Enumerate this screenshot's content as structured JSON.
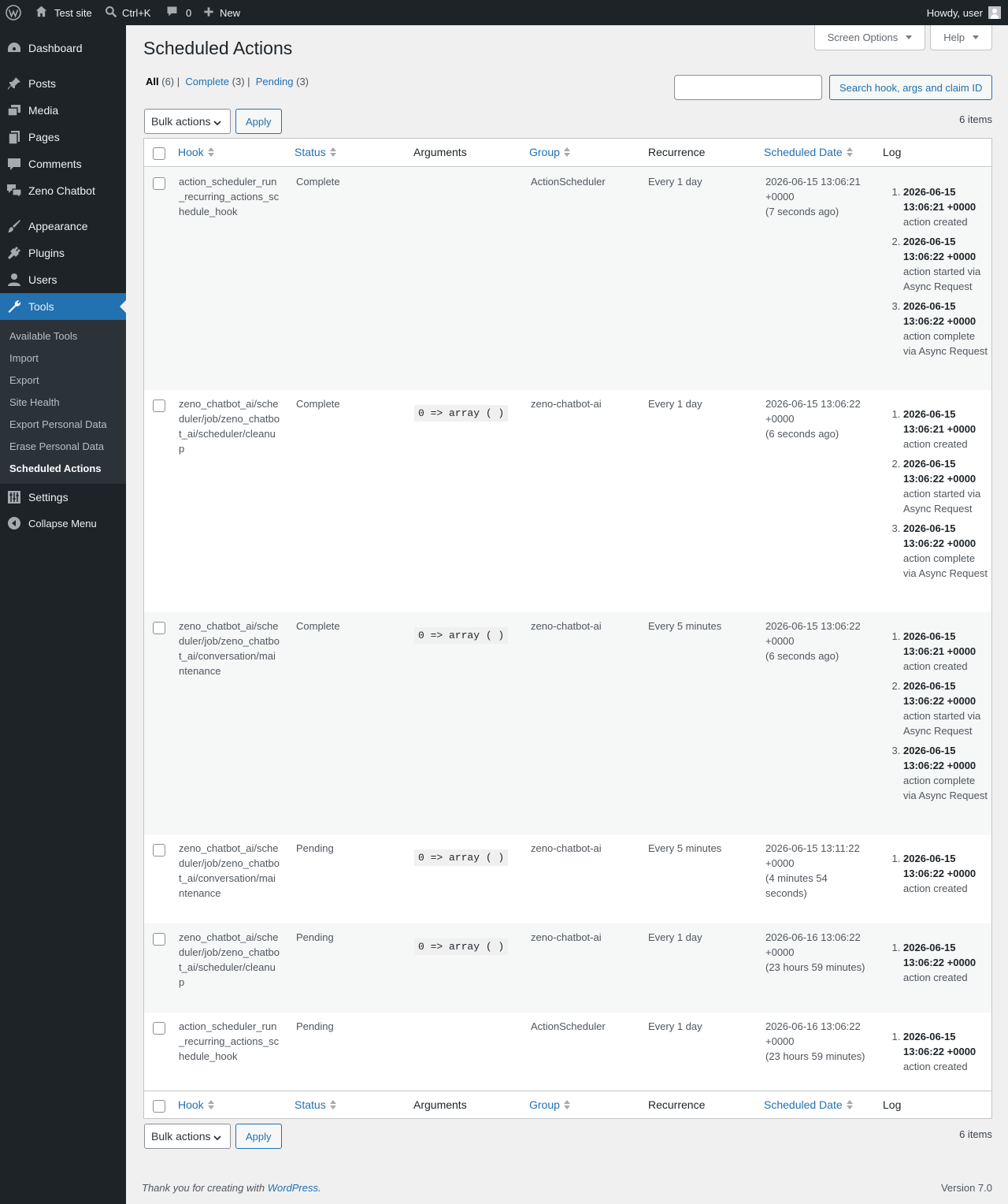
{
  "adminbar": {
    "site_name": "Test site",
    "search_shortcut": "Ctrl+K",
    "comments_count": "0",
    "new_label": "New",
    "howdy": "Howdy, user"
  },
  "sidebar": {
    "items": [
      {
        "label": "Dashboard",
        "icon": "dashboard-icon"
      },
      {
        "label": "Posts",
        "icon": "pin-icon"
      },
      {
        "label": "Media",
        "icon": "media-icon"
      },
      {
        "label": "Pages",
        "icon": "pages-icon"
      },
      {
        "label": "Comments",
        "icon": "comment-icon"
      },
      {
        "label": "Zeno Chatbot",
        "icon": "chat-icon"
      },
      {
        "label": "Appearance",
        "icon": "brush-icon"
      },
      {
        "label": "Plugins",
        "icon": "plugin-icon"
      },
      {
        "label": "Users",
        "icon": "user-icon"
      },
      {
        "label": "Tools",
        "icon": "wrench-icon"
      },
      {
        "label": "Settings",
        "icon": "settings-icon"
      },
      {
        "label": "Collapse Menu",
        "icon": "collapse-icon"
      }
    ],
    "tools_submenu": [
      "Available Tools",
      "Import",
      "Export",
      "Site Health",
      "Export Personal Data",
      "Erase Personal Data",
      "Scheduled Actions"
    ]
  },
  "screen_meta": {
    "screen_options": "Screen Options",
    "help": "Help"
  },
  "page": {
    "title": "Scheduled Actions",
    "filters": [
      {
        "label": "All",
        "count": "(6)",
        "sep": " |"
      },
      {
        "label": "Complete",
        "count": "(3)",
        "sep": " |"
      },
      {
        "label": "Pending",
        "count": "(3)",
        "sep": ""
      }
    ],
    "search_button": "Search hook, args and claim ID",
    "bulk_actions": "Bulk actions",
    "apply": "Apply",
    "items_count": "6 items"
  },
  "table": {
    "headers": {
      "hook": "Hook",
      "status": "Status",
      "arguments": "Arguments",
      "group": "Group",
      "recurrence": "Recurrence",
      "scheduled_date": "Scheduled Date",
      "log": "Log"
    },
    "rows": [
      {
        "hook": "action_scheduler_run_recurring_actions_schedule_hook",
        "status": "Complete",
        "args": "",
        "group": "ActionScheduler",
        "recurrence": "Every 1 day",
        "sched_date": "2026-06-15 13:06:21 +0000",
        "sched_rel": "(7 seconds ago)",
        "log": [
          {
            "date": "2026-06-15 13:06:21 +0000",
            "msg": "action created"
          },
          {
            "date": "2026-06-15 13:06:22 +0000",
            "msg": "action started via Async Request"
          },
          {
            "date": "2026-06-15 13:06:22 +0000",
            "msg": "action complete via Async Request"
          }
        ]
      },
      {
        "hook": "zeno_chatbot_ai/scheduler/job/zeno_chatbot_ai/scheduler/cleanup",
        "status": "Complete",
        "args": "0 => array ( )",
        "group": "zeno-chatbot-ai",
        "recurrence": "Every 1 day",
        "sched_date": "2026-06-15 13:06:22 +0000",
        "sched_rel": "(6 seconds ago)",
        "log": [
          {
            "date": "2026-06-15 13:06:21 +0000",
            "msg": "action created"
          },
          {
            "date": "2026-06-15 13:06:22 +0000",
            "msg": "action started via Async Request"
          },
          {
            "date": "2026-06-15 13:06:22 +0000",
            "msg": "action complete via Async Request"
          }
        ]
      },
      {
        "hook": "zeno_chatbot_ai/scheduler/job/zeno_chatbot_ai/conversation/maintenance",
        "status": "Complete",
        "args": "0 => array ( )",
        "group": "zeno-chatbot-ai",
        "recurrence": "Every 5 minutes",
        "sched_date": "2026-06-15 13:06:22 +0000",
        "sched_rel": "(6 seconds ago)",
        "log": [
          {
            "date": "2026-06-15 13:06:21 +0000",
            "msg": "action created"
          },
          {
            "date": "2026-06-15 13:06:22 +0000",
            "msg": "action started via Async Request"
          },
          {
            "date": "2026-06-15 13:06:22 +0000",
            "msg": "action complete via Async Request"
          }
        ]
      },
      {
        "hook": "zeno_chatbot_ai/scheduler/job/zeno_chatbot_ai/conversation/maintenance",
        "status": "Pending",
        "args": "0 => array ( )",
        "group": "zeno-chatbot-ai",
        "recurrence": "Every 5 minutes",
        "sched_date": "2026-06-15 13:11:22 +0000",
        "sched_rel": "(4 minutes 54 seconds)",
        "log": [
          {
            "date": "2026-06-15 13:06:22 +0000",
            "msg": "action created"
          }
        ]
      },
      {
        "hook": "zeno_chatbot_ai/scheduler/job/zeno_chatbot_ai/scheduler/cleanup",
        "status": "Pending",
        "args": "0 => array ( )",
        "group": "zeno-chatbot-ai",
        "recurrence": "Every 1 day",
        "sched_date": "2026-06-16 13:06:22 +0000",
        "sched_rel": "(23 hours 59 minutes)",
        "log": [
          {
            "date": "2026-06-15 13:06:22 +0000",
            "msg": "action created"
          }
        ]
      },
      {
        "hook": "action_scheduler_run_recurring_actions_schedule_hook",
        "status": "Pending",
        "args": "",
        "group": "ActionScheduler",
        "recurrence": "Every 1 day",
        "sched_date": "2026-06-16 13:06:22 +0000",
        "sched_rel": "(23 hours 59 minutes)",
        "log": [
          {
            "date": "2026-06-15 13:06:22 +0000",
            "msg": "action created"
          }
        ]
      }
    ]
  },
  "footer": {
    "thanks_prefix": "Thank you for creating with ",
    "wp_link": "WordPress",
    "thanks_suffix": ".",
    "version": "Version 7.0"
  }
}
